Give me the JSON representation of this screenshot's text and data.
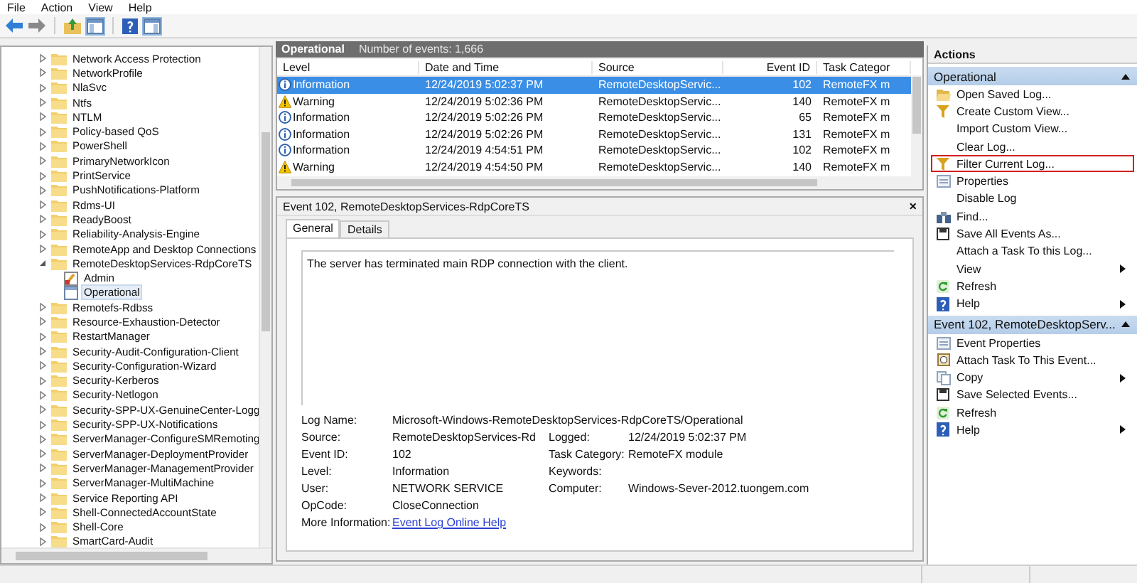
{
  "menu": [
    "File",
    "Action",
    "View",
    "Help"
  ],
  "tree": [
    {
      "label": "Network Access Protection",
      "expanded": false,
      "selected": false
    },
    {
      "label": "NetworkProfile",
      "expanded": false,
      "selected": false
    },
    {
      "label": "NlaSvc",
      "expanded": false,
      "selected": false
    },
    {
      "label": "Ntfs",
      "expanded": false,
      "selected": false
    },
    {
      "label": "NTLM",
      "expanded": false,
      "selected": false
    },
    {
      "label": "Policy-based QoS",
      "expanded": false,
      "selected": false
    },
    {
      "label": "PowerShell",
      "expanded": false,
      "selected": false
    },
    {
      "label": "PrimaryNetworkIcon",
      "expanded": false,
      "selected": false
    },
    {
      "label": "PrintService",
      "expanded": false,
      "selected": false
    },
    {
      "label": "PushNotifications-Platform",
      "expanded": false,
      "selected": false
    },
    {
      "label": "Rdms-UI",
      "expanded": false,
      "selected": false
    },
    {
      "label": "ReadyBoost",
      "expanded": false,
      "selected": false
    },
    {
      "label": "Reliability-Analysis-Engine",
      "expanded": false,
      "selected": false
    },
    {
      "label": "RemoteApp and Desktop Connections",
      "expanded": false,
      "selected": false
    },
    {
      "label": "RemoteDesktopServices-RdpCoreTS",
      "expanded": true,
      "selected": false,
      "children": [
        {
          "label": "Admin",
          "kind": "admin",
          "selected": false
        },
        {
          "label": "Operational",
          "kind": "log",
          "selected": true
        }
      ]
    },
    {
      "label": "Remotefs-Rdbss",
      "expanded": false,
      "selected": false
    },
    {
      "label": "Resource-Exhaustion-Detector",
      "expanded": false,
      "selected": false
    },
    {
      "label": "RestartManager",
      "expanded": false,
      "selected": false
    },
    {
      "label": "Security-Audit-Configuration-Client",
      "expanded": false,
      "selected": false
    },
    {
      "label": "Security-Configuration-Wizard",
      "expanded": false,
      "selected": false
    },
    {
      "label": "Security-Kerberos",
      "expanded": false,
      "selected": false
    },
    {
      "label": "Security-Netlogon",
      "expanded": false,
      "selected": false
    },
    {
      "label": "Security-SPP-UX-GenuineCenter-Logg",
      "expanded": false,
      "selected": false
    },
    {
      "label": "Security-SPP-UX-Notifications",
      "expanded": false,
      "selected": false
    },
    {
      "label": "ServerManager-ConfigureSMRemoting",
      "expanded": false,
      "selected": false
    },
    {
      "label": "ServerManager-DeploymentProvider",
      "expanded": false,
      "selected": false
    },
    {
      "label": "ServerManager-ManagementProvider",
      "expanded": false,
      "selected": false
    },
    {
      "label": "ServerManager-MultiMachine",
      "expanded": false,
      "selected": false
    },
    {
      "label": "Service Reporting API",
      "expanded": false,
      "selected": false
    },
    {
      "label": "Shell-ConnectedAccountState",
      "expanded": false,
      "selected": false
    },
    {
      "label": "Shell-Core",
      "expanded": false,
      "selected": false
    },
    {
      "label": "SmartCard-Audit",
      "expanded": false,
      "selected": false
    }
  ],
  "log_header": {
    "title": "Operational",
    "count": "Number of events: 1,666"
  },
  "table": {
    "columns": [
      "Level",
      "Date and Time",
      "Source",
      "Event ID",
      "Task Categor"
    ],
    "rows": [
      {
        "kind": "information",
        "severity": "Information",
        "date": "12/24/2019 5:02:37 PM",
        "source": "RemoteDesktopServic...",
        "event_id": "102",
        "category": "RemoteFX m",
        "selected": true
      },
      {
        "kind": "warning",
        "severity": "Warning",
        "date": "12/24/2019 5:02:36 PM",
        "source": "RemoteDesktopServic...",
        "event_id": "140",
        "category": "RemoteFX m",
        "selected": false
      },
      {
        "kind": "information",
        "severity": "Information",
        "date": "12/24/2019 5:02:26 PM",
        "source": "RemoteDesktopServic...",
        "event_id": "65",
        "category": "RemoteFX m",
        "selected": false
      },
      {
        "kind": "information",
        "severity": "Information",
        "date": "12/24/2019 5:02:26 PM",
        "source": "RemoteDesktopServic...",
        "event_id": "131",
        "category": "RemoteFX m",
        "selected": false
      },
      {
        "kind": "information",
        "severity": "Information",
        "date": "12/24/2019 4:54:51 PM",
        "source": "RemoteDesktopServic...",
        "event_id": "102",
        "category": "RemoteFX m",
        "selected": false
      },
      {
        "kind": "warning",
        "severity": "Warning",
        "date": "12/24/2019 4:54:50 PM",
        "source": "RemoteDesktopServic...",
        "event_id": "140",
        "category": "RemoteFX m",
        "selected": false
      }
    ]
  },
  "detail": {
    "title": "Event 102, RemoteDesktopServices-RdpCoreTS",
    "close": "×",
    "tabs": [
      {
        "label": "General",
        "selected": true
      },
      {
        "label": "Details",
        "selected": false
      }
    ],
    "message": "The server has terminated main RDP connection with the client.",
    "log_name": {
      "label": "Log Name:",
      "value": "Microsoft-Windows-RemoteDesktopServices-RdpCoreTS/Operational"
    },
    "fields": [
      [
        {
          "label": "Source:",
          "value": "RemoteDesktopServices-Rd"
        },
        {
          "label": "Logged:",
          "value": "12/24/2019 5:02:37 PM"
        }
      ],
      [
        {
          "label": "Event ID:",
          "value": "102"
        },
        {
          "label": "Task Category:",
          "value": "RemoteFX module"
        }
      ],
      [
        {
          "label": "Level:",
          "value": "Information"
        },
        {
          "label": "Keywords:"
        }
      ],
      [
        {
          "label": "User:",
          "value": "NETWORK SERVICE"
        },
        {
          "label": "Computer:",
          "value": "Windows-Sever-2012.tuongem.com"
        }
      ],
      [
        {
          "label": "OpCode:",
          "value": "CloseConnection"
        }
      ]
    ],
    "more_info": {
      "label": "More Information:",
      "link": "Event Log Online Help"
    }
  },
  "actions": {
    "title": "Actions",
    "sections": [
      {
        "title": "Operational",
        "expanded": true,
        "items": [
          {
            "label": "Open Saved Log...",
            "kind": "folder",
            "submenu": false,
            "highlighted": false
          },
          {
            "label": "Create Custom View...",
            "kind": "filter",
            "submenu": false,
            "highlighted": false
          },
          {
            "label": "Import Custom View...",
            "kind": "plain",
            "submenu": false,
            "highlighted": false
          },
          {
            "label": "Clear Log...",
            "kind": "plain",
            "submenu": false,
            "highlighted": false
          },
          {
            "label": "Filter Current Log...",
            "kind": "filter",
            "submenu": false,
            "highlighted": true
          },
          {
            "label": "Properties",
            "kind": "properties",
            "submenu": false,
            "highlighted": false
          },
          {
            "label": "Disable Log",
            "kind": "plain",
            "submenu": false,
            "highlighted": false
          },
          {
            "label": "Find...",
            "kind": "find",
            "submenu": false,
            "highlighted": false
          },
          {
            "label": "Save All Events As...",
            "kind": "save",
            "submenu": false,
            "highlighted": false
          },
          {
            "label": "Attach a Task To this Log...",
            "kind": "plain",
            "submenu": false,
            "highlighted": false
          },
          {
            "label": "View",
            "kind": "plain",
            "submenu": true,
            "highlighted": false
          },
          {
            "label": "Refresh",
            "kind": "refresh",
            "submenu": false,
            "highlighted": false
          },
          {
            "label": "Help",
            "kind": "help",
            "submenu": true,
            "highlighted": false
          }
        ]
      },
      {
        "title": "Event 102, RemoteDesktopServ...",
        "expanded": true,
        "items": [
          {
            "label": "Event Properties",
            "kind": "properties",
            "submenu": false,
            "highlighted": false
          },
          {
            "label": "Attach Task To This Event...",
            "kind": "task",
            "submenu": false,
            "highlighted": false
          },
          {
            "label": "Copy",
            "kind": "copy",
            "submenu": true,
            "highlighted": false
          },
          {
            "label": "Save Selected Events...",
            "kind": "save",
            "submenu": false,
            "highlighted": false
          },
          {
            "label": "Refresh",
            "kind": "refresh",
            "submenu": false,
            "highlighted": false
          },
          {
            "label": "Help",
            "kind": "help",
            "submenu": true,
            "highlighted": false
          }
        ]
      }
    ]
  }
}
